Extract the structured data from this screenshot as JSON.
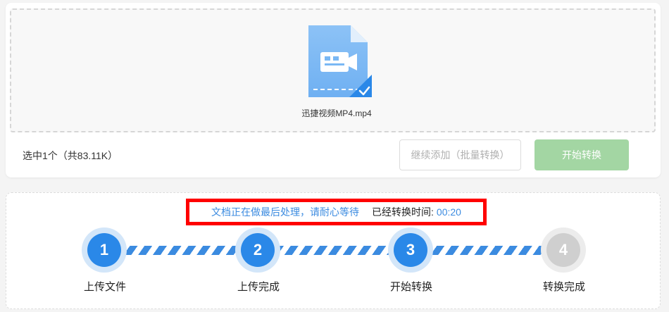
{
  "upload": {
    "file_name": "迅捷视频MP4.mp4",
    "selection_info": "选中1个（共83.11K）",
    "continue_button": "继续添加（批量转换）",
    "start_button": "开始转换"
  },
  "progress": {
    "status_message": "文档正在做最后处理，请耐心等待",
    "elapsed_label": "已经转换时间:",
    "elapsed_time": "00:20",
    "steps": [
      {
        "number": "1",
        "label": "上传文件",
        "state": "active"
      },
      {
        "number": "2",
        "label": "上传完成",
        "state": "active"
      },
      {
        "number": "3",
        "label": "开始转换",
        "state": "active"
      },
      {
        "number": "4",
        "label": "转换完成",
        "state": "pending"
      }
    ]
  },
  "colors": {
    "accent_blue": "#2a88e8",
    "start_button_green": "#a3d6a3",
    "highlight_red": "#ff0000",
    "pending_gray": "#cfcfcf"
  },
  "icons": {
    "file": "video-file-icon",
    "check": "checkmark-icon"
  }
}
